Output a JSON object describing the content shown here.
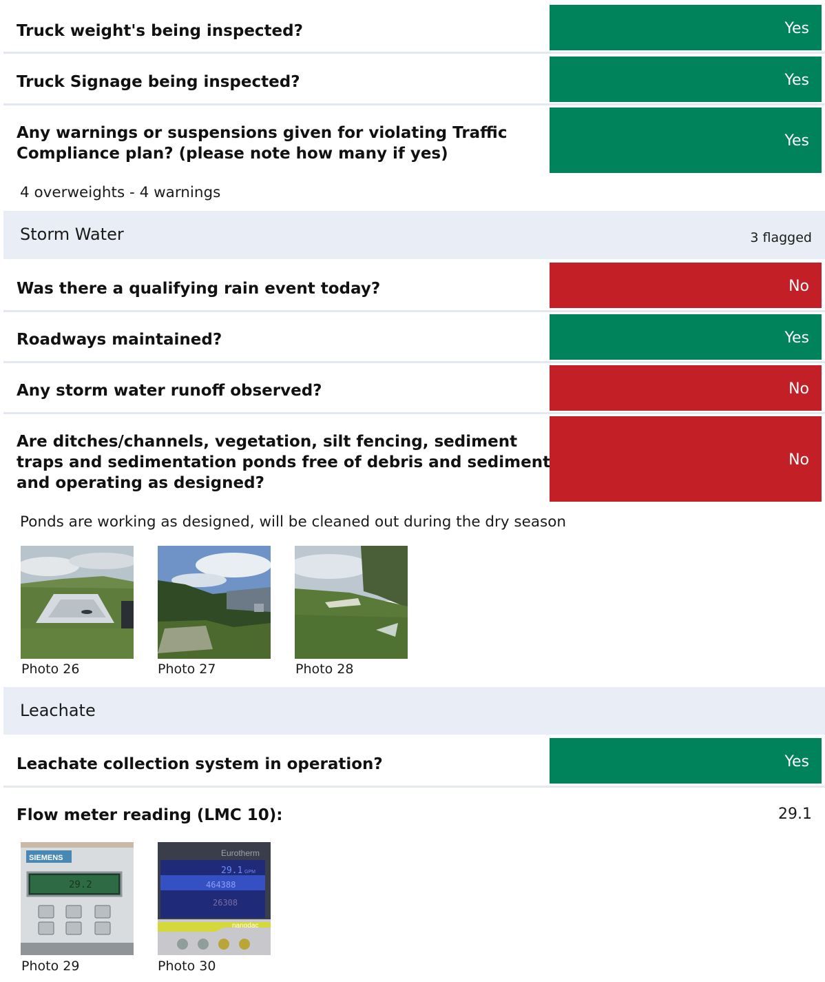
{
  "items": [
    {
      "question": "Truck weight's being inspected?",
      "answer": "Yes"
    },
    {
      "question": "Truck Signage being inspected?",
      "answer": "Yes"
    },
    {
      "question_lines": [
        "Any warnings or suspensions given for violating Traffic",
        "Compliance plan? (please note how many if yes)"
      ],
      "answer": "Yes",
      "note": "4 overweights - 4 warnings"
    }
  ],
  "sections": [
    {
      "title": "Storm Water",
      "flagged": "3 flagged"
    },
    {
      "title": "Leachate"
    }
  ],
  "storm_water": [
    {
      "question": "Was there a qualifying rain event today?",
      "answer": "No"
    },
    {
      "question": "Roadways maintained?",
      "answer": "Yes"
    },
    {
      "question": "Any storm water runoff observed?",
      "answer": "No"
    },
    {
      "question_lines": [
        "Are ditches/channels, vegetation, silt fencing, sediment",
        "traps and sedimentation ponds free of debris and sediment",
        "and operating as designed?"
      ],
      "answer": "No",
      "note": "Ponds are working as designed, will be cleaned out during the dry season"
    }
  ],
  "storm_photos": [
    "Photo 26",
    "Photo 27",
    "Photo 28"
  ],
  "leachate": [
    {
      "question": "Leachate collection system in operation?",
      "answer": "Yes"
    },
    {
      "question": "Flow meter reading (LMC 10):",
      "value": "29.1"
    }
  ],
  "leachate_photos": [
    "Photo 29",
    "Photo 30"
  ],
  "photo_text": {
    "siemens": "SIEMENS",
    "siemens_display": "29.2",
    "eurotherm": "Eurotherm",
    "eurotherm_reading": "29.1",
    "eurotherm_unit": "GPM",
    "eurotherm_total": "464388",
    "eurotherm_second": "26308",
    "nanodac": "nanodac"
  },
  "colors": {
    "yes": "#00825a",
    "no": "#c21f27",
    "section_bg": "#e9edf5"
  }
}
